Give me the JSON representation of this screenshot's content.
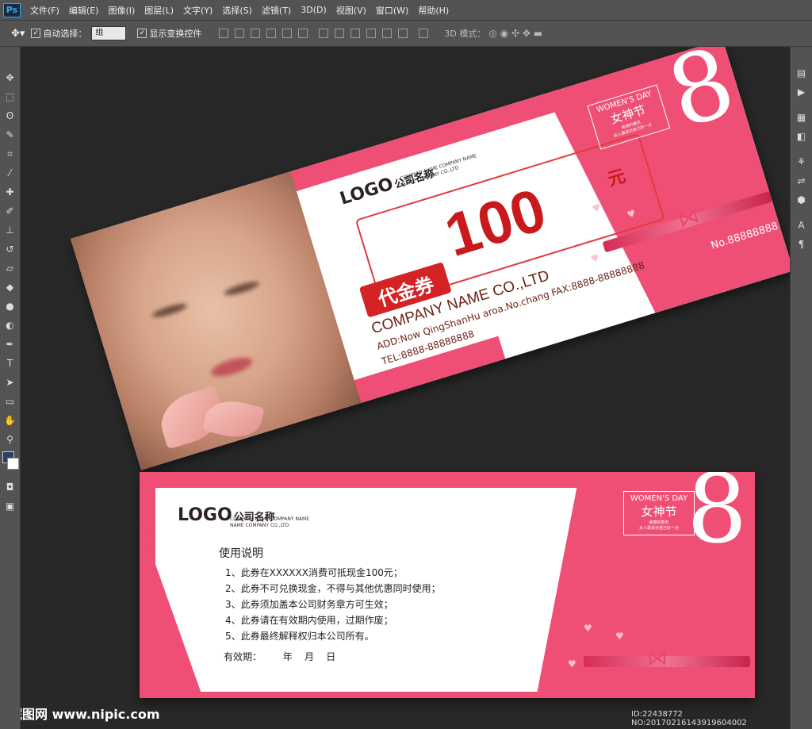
{
  "app": {
    "logo": "Ps"
  },
  "menu": [
    "文件(F)",
    "编辑(E)",
    "图像(I)",
    "图层(L)",
    "文字(Y)",
    "选择(S)",
    "滤镜(T)",
    "3D(D)",
    "视图(V)",
    "窗口(W)",
    "帮助(H)"
  ],
  "options": {
    "auto_select_label": "自动选择：",
    "auto_select_value": "组",
    "show_transform_label": "显示变换控件",
    "mode3d_label": "3D 模式："
  },
  "card1": {
    "logo": "LOGO",
    "company_cn": "公司名称",
    "company_small1": "COMPANY NAME COMPANY NAME",
    "company_small2": "NAME COMPANY CO.,LTD",
    "voucher_label": "代金券",
    "amount": "100",
    "yuan": "元",
    "company_name": "COMPANY NAME CO.,LTD",
    "address": "ADD:Now QingShanHu aroa.No.chang",
    "fax": "FAX:8888-88888888",
    "tel": "TEL:8888-88888888",
    "number": "No.88888888",
    "womens_day": "WOMEN'S DAY",
    "festival": "女神节",
    "tagline1": "美丽的春天",
    "tagline2": "女人最该对自己好一点",
    "eight": "8"
  },
  "card2": {
    "logo": "LOGO",
    "company_cn": "公司名称",
    "company_small1": "COMPANY NAME COMPANY NAME",
    "company_small2": "NAME COMPANY CO.,LTD",
    "usage_title": "使用说明",
    "rules": [
      "1、此券在XXXXXX消费可抵现金100元；",
      "2、此券不可兑换现金，不得与其他优惠同时使用；",
      "3、此券须加盖本公司财务章方可生效；",
      "4、此券请在有效期内使用，过期作废；",
      "5、此券最终解释权归本公司所有。"
    ],
    "validity": "有效期：       年    月    日",
    "womens_day": "WOMEN'S DAY",
    "festival": "女神节",
    "tagline1": "美丽的春天",
    "tagline2": "女人最该对自己好一点",
    "eight": "8"
  },
  "footer": {
    "watermark": "昵图网 www.nipic.com",
    "id": "ID:22438772 NO:20170216143919604002"
  },
  "colors": {
    "pink": "#ef4f75",
    "red": "#d32324",
    "ps_bg": "#282828",
    "panel": "#535353"
  }
}
